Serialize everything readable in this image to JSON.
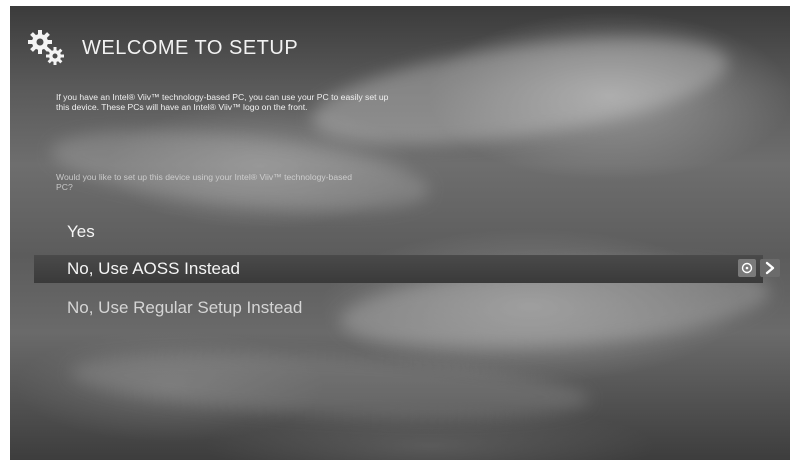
{
  "header": {
    "title": "WELCOME TO SETUP",
    "icon": "gears-icon"
  },
  "intro_text": "If you have an Intel® Viiv™ technology-based PC, you can use your PC to easily set up this device. These PCs will have an Intel® Viiv™ logo on the front.",
  "question_text": "Would you like to set up this device using your Intel® Viiv™ technology-based PC?",
  "options": [
    {
      "label": "Yes",
      "selected": false
    },
    {
      "label": "No, Use AOSS Instead",
      "selected": true
    },
    {
      "label": "No, Use Regular Setup Instead",
      "selected": false
    }
  ],
  "controls": {
    "info_icon": "info-circle-icon",
    "next_icon": "chevron-right-icon"
  }
}
